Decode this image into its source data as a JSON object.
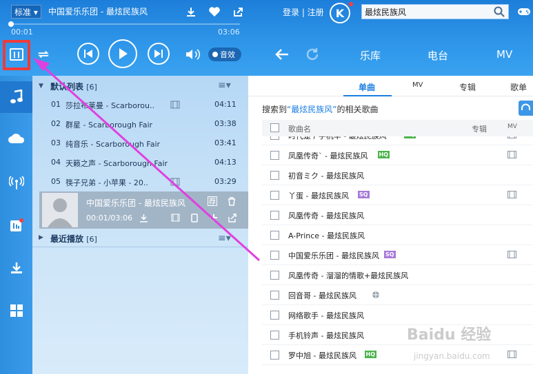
{
  "header": {
    "quality": "标准",
    "song_title": "中国爱乐乐团 - 最炫民族风",
    "time_current": "00:01",
    "time_total": "03:06",
    "progress": 0.005,
    "effect_label": "音效",
    "login_text": "登录 | 注册",
    "k_logo": "K",
    "search_value": "最炫民族风"
  },
  "main_tabs": [
    "乐库",
    "电台",
    "MV"
  ],
  "playlist": {
    "default_list": {
      "name": "默认列表",
      "count": "[6]"
    },
    "songs": [
      {
        "num": "01",
        "title": "莎拉布莱曼 - Scarborou..",
        "dur": "04:11",
        "mv": true
      },
      {
        "num": "02",
        "title": "群星 - Scarborough Fair",
        "dur": "03:38",
        "mv": false
      },
      {
        "num": "03",
        "title": "纯音乐 - Scarborough Fair",
        "dur": "03:41",
        "mv": false
      },
      {
        "num": "04",
        "title": "天籁之声 - Scarborough Fair",
        "dur": "04:13",
        "mv": false
      },
      {
        "num": "05",
        "title": "筷子兄弟 - 小苹果 - 20..",
        "dur": "03:29",
        "mv": true
      }
    ],
    "now_playing": {
      "title": "中国爱乐乐团 - 最炫民族风",
      "time": "00:01/03:06",
      "tag": "荐"
    },
    "recent_list": {
      "name": "最近播放",
      "count": "[6]"
    }
  },
  "content": {
    "sub_tabs": [
      "单曲",
      "MV",
      "专辑",
      "歌单"
    ],
    "search_note_prefix": "搜索到",
    "search_note_keyword": "“最炫民族风”",
    "search_note_suffix": "的相关歌曲",
    "columns": {
      "name": "歌曲名",
      "album": "专辑",
      "mv": "MV"
    },
    "results": [
      {
        "title": "时代楚 / 手机华 - 最炫民族风",
        "badge": "HQ",
        "globe": false,
        "mv": true
      },
      {
        "title": "凤凰传奇` - 最炫民族风",
        "badge": "HQ",
        "globe": false,
        "mv": true
      },
      {
        "title": "初音ミク - 最炫民族风",
        "badge": "",
        "globe": false,
        "mv": false
      },
      {
        "title": "丫蛋 - 最炫民族风",
        "badge": "SQ",
        "globe": false,
        "mv": true
      },
      {
        "title": "风凰传奇 - 最炫民族风",
        "badge": "",
        "globe": false,
        "mv": false
      },
      {
        "title": "A-Prince - 最炫民族风",
        "badge": "",
        "globe": false,
        "mv": false
      },
      {
        "title": "中国爱乐乐团 - 最炫民族风",
        "badge": "SQ",
        "globe": false,
        "mv": true
      },
      {
        "title": "风凰传奇 - 溜溜的情歌+最炫民族风",
        "badge": "",
        "globe": false,
        "mv": false
      },
      {
        "title": "回音哥 - 最炫民族风",
        "badge": "",
        "globe": true,
        "mv": false
      },
      {
        "title": "网络歌手 - 最炫民族风",
        "badge": "",
        "globe": false,
        "mv": false
      },
      {
        "title": "手机铃声 - 最炫民族风",
        "badge": "",
        "globe": false,
        "mv": false
      },
      {
        "title": "罗中旭 - 最炫民族风",
        "badge": "HQ",
        "globe": false,
        "mv": true
      }
    ]
  },
  "watermark": {
    "main": "Baidu 经验",
    "sub": "jingyan.baidu.com"
  },
  "colors": {
    "accent": "#1a7ee0",
    "annotation": "#ee3b3b",
    "arrow": "#e040e0"
  }
}
